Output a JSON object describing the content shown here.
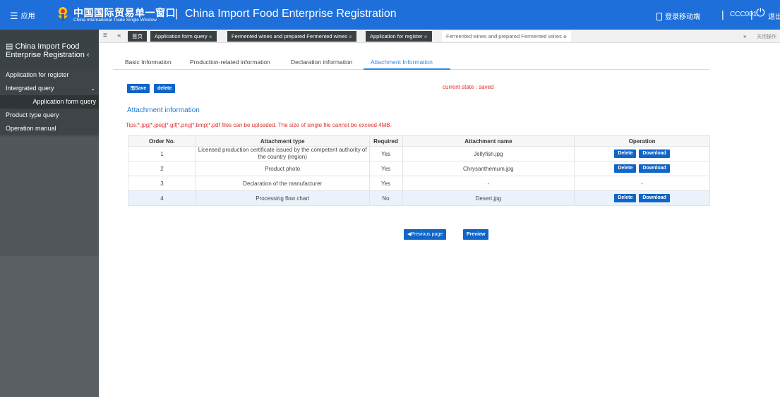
{
  "header": {
    "menu_label": "应用",
    "logo_cn": "中国国际贸易单一窗口",
    "logo_en": "China International Trade Single Window",
    "app_title": "China Import Food Enterprise Registration",
    "mobile_login": "登录移动端",
    "username": "CCC001",
    "logout": "退出"
  },
  "sidebar": {
    "title_line1": "China Import Food",
    "title_line2": "Enterprise Registration",
    "items": [
      {
        "label": "Application for register"
      },
      {
        "label": "Intergrated query"
      },
      {
        "label": "Application form query"
      },
      {
        "label": "Product type query"
      },
      {
        "label": "Operation manual"
      }
    ]
  },
  "tabstrip": {
    "tabs": [
      {
        "label": "首页"
      },
      {
        "label": "Application form query"
      },
      {
        "label": "Fermented wines and prepared Fermented wines"
      },
      {
        "label": "Application for register"
      },
      {
        "label": "Fermented wines and prepared Fermented wines"
      }
    ],
    "close_ops": "关闭操作"
  },
  "subtabs": [
    {
      "label": "Basic Information"
    },
    {
      "label": "Production-related information"
    },
    {
      "label": "Declaration information"
    },
    {
      "label": "Attachment Information"
    }
  ],
  "toolbar": {
    "save_label": "Save",
    "delete_label": "delete",
    "state": "current state : saved"
  },
  "section": {
    "title": "Attachment information",
    "tips": "Tips:*.jpg|*.jpeg|*.gif|*.png|*.bmp|*.pdf files can be uploaded. The size of single file cannot be exceed 4MB."
  },
  "table": {
    "headers": [
      "Order No.",
      "Attachment type",
      "Required",
      "Attachment name",
      "Operation"
    ],
    "rows": [
      {
        "order": "1",
        "type": "Licensed production certificate issued by the competent authority of the country (region)",
        "required": "Yes",
        "name": "Jellyfish.jpg",
        "delete": "Delete",
        "download": "Download"
      },
      {
        "order": "2",
        "type": "Product photo",
        "required": "Yes",
        "name": "Chrysanthemum.jpg",
        "delete": "Delete",
        "download": "Download"
      },
      {
        "order": "3",
        "type": "Declaration of the manufacturer",
        "required": "Yes",
        "name": "-",
        "op": "-"
      },
      {
        "order": "4",
        "type": "Processing flow chart",
        "required": "No",
        "name": "Desert.jpg",
        "delete": "Delete",
        "download": "Download"
      }
    ]
  },
  "footer": {
    "previous": "Previous page",
    "preview": "Preview"
  },
  "colors": {
    "header_bg": "#1e6fd9",
    "sidebar_bg": "#4b5155",
    "primary_button": "#0f65c8",
    "active_tab": "#2f8be6",
    "alert_text": "#e0302c"
  }
}
